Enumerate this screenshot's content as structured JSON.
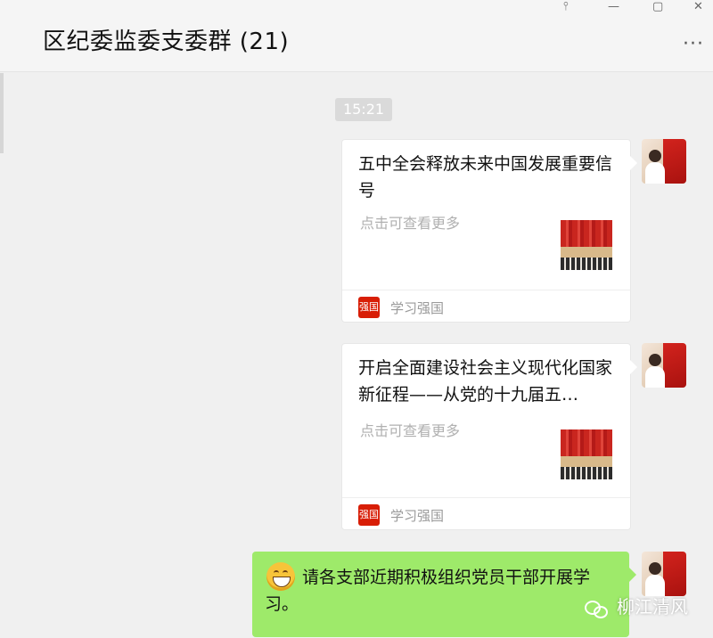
{
  "window": {
    "title": "区纪委监委支委群 (21)",
    "controls": {
      "pin": "⫯",
      "minimize": "—",
      "maximize": "▢",
      "close": "✕"
    },
    "more": "···"
  },
  "chat": {
    "timestamp": "15:21",
    "cards": [
      {
        "title": "五中全会释放未来中国发展重要信号",
        "desc": "点击可查看更多",
        "source_icon": "强国",
        "source": "学习强国"
      },
      {
        "title": "开启全面建设社会主义现代化国家新征程——从党的十九届五…",
        "desc": "点击可查看更多",
        "source_icon": "强国",
        "source": "学习强国"
      }
    ],
    "text_message": "请各支部近期积极组织党员干部开展学习。"
  },
  "watermark": "柳江清风",
  "colors": {
    "bubble_green": "#9eea6a",
    "source_red": "#d81e06",
    "background": "#f0f0f0"
  }
}
